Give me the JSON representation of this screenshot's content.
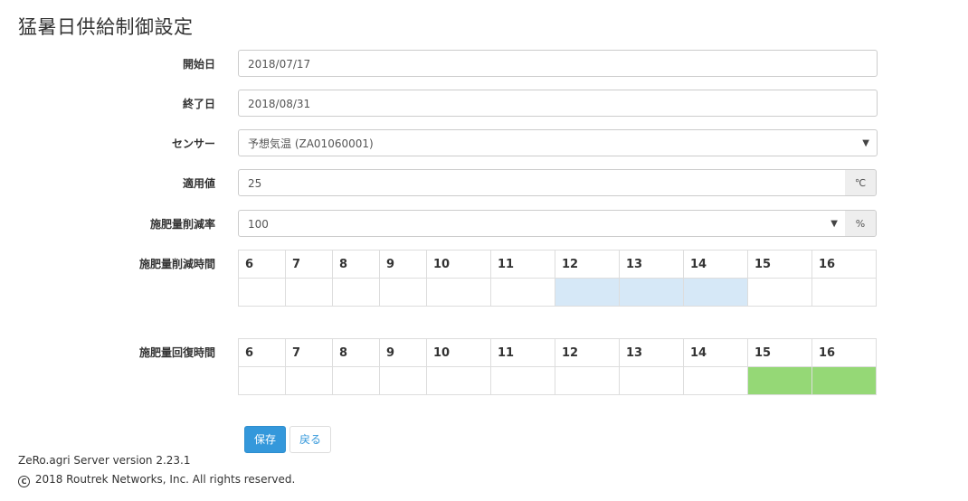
{
  "page": {
    "title": "猛暑日供給制御設定"
  },
  "form": {
    "start_date": {
      "label": "開始日",
      "value": "2018/07/17"
    },
    "end_date": {
      "label": "終了日",
      "value": "2018/08/31"
    },
    "sensor": {
      "label": "センサー",
      "value": "予想気温 (ZA01060001)"
    },
    "threshold": {
      "label": "適用値",
      "value": "25",
      "unit": "℃"
    },
    "reduction_rate": {
      "label": "施肥量削減率",
      "value": "100",
      "unit": "%"
    },
    "reduction_hours": {
      "label": "施肥量削減時間",
      "hours": [
        "6",
        "7",
        "8",
        "9",
        "10",
        "11",
        "12",
        "13",
        "14",
        "15",
        "16"
      ],
      "selected": [
        false,
        false,
        false,
        false,
        false,
        false,
        true,
        true,
        true,
        false,
        false
      ],
      "highlight_color": "#d6e8f7"
    },
    "recovery_hours": {
      "label": "施肥量回復時間",
      "hours": [
        "6",
        "7",
        "8",
        "9",
        "10",
        "11",
        "12",
        "13",
        "14",
        "15",
        "16"
      ],
      "selected": [
        false,
        false,
        false,
        false,
        false,
        false,
        false,
        false,
        false,
        true,
        true
      ],
      "highlight_color": "#95d876"
    }
  },
  "buttons": {
    "save_label": "保存",
    "back_label": "戻る"
  },
  "footer": {
    "version": "ZeRo.agri Server version 2.23.1",
    "copyright_symbol": "C",
    "copyright": "2018 Routrek Networks, Inc. All rights reserved."
  }
}
